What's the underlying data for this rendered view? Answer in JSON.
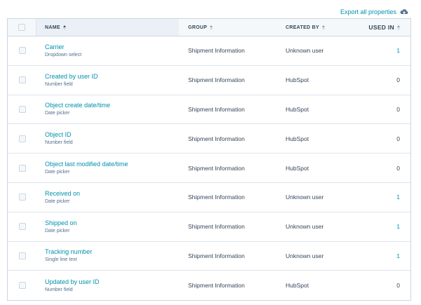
{
  "export_label": "Export all properties",
  "columns": {
    "name": "NAME",
    "group": "GROUP",
    "created_by": "CREATED BY",
    "used_in": "USED IN"
  },
  "rows": [
    {
      "name": "Carrier",
      "type": "Dropdown select",
      "group": "Shipment Information",
      "created_by": "Unknown user",
      "used_in": "1"
    },
    {
      "name": "Created by user ID",
      "type": "Number field",
      "group": "Shipment Information",
      "created_by": "HubSpot",
      "used_in": "0"
    },
    {
      "name": "Object create date/time",
      "type": "Date picker",
      "group": "Shipment Information",
      "created_by": "HubSpot",
      "used_in": "0"
    },
    {
      "name": "Object ID",
      "type": "Number field",
      "group": "Shipment Information",
      "created_by": "HubSpot",
      "used_in": "0"
    },
    {
      "name": "Object last modified date/time",
      "type": "Date picker",
      "group": "Shipment Information",
      "created_by": "HubSpot",
      "used_in": "0"
    },
    {
      "name": "Received on",
      "type": "Date picker",
      "group": "Shipment Information",
      "created_by": "Unknown user",
      "used_in": "1"
    },
    {
      "name": "Shipped on",
      "type": "Date picker",
      "group": "Shipment Information",
      "created_by": "Unknown user",
      "used_in": "1"
    },
    {
      "name": "Tracking number",
      "type": "Single line text",
      "group": "Shipment Information",
      "created_by": "Unknown user",
      "used_in": "1"
    },
    {
      "name": "Updated by user ID",
      "type": "Number field",
      "group": "Shipment Information",
      "created_by": "HubSpot",
      "used_in": "0"
    }
  ],
  "colors": {
    "link": "#0091ae",
    "text": "#33475b",
    "header_bg": "#f5f8fa"
  }
}
